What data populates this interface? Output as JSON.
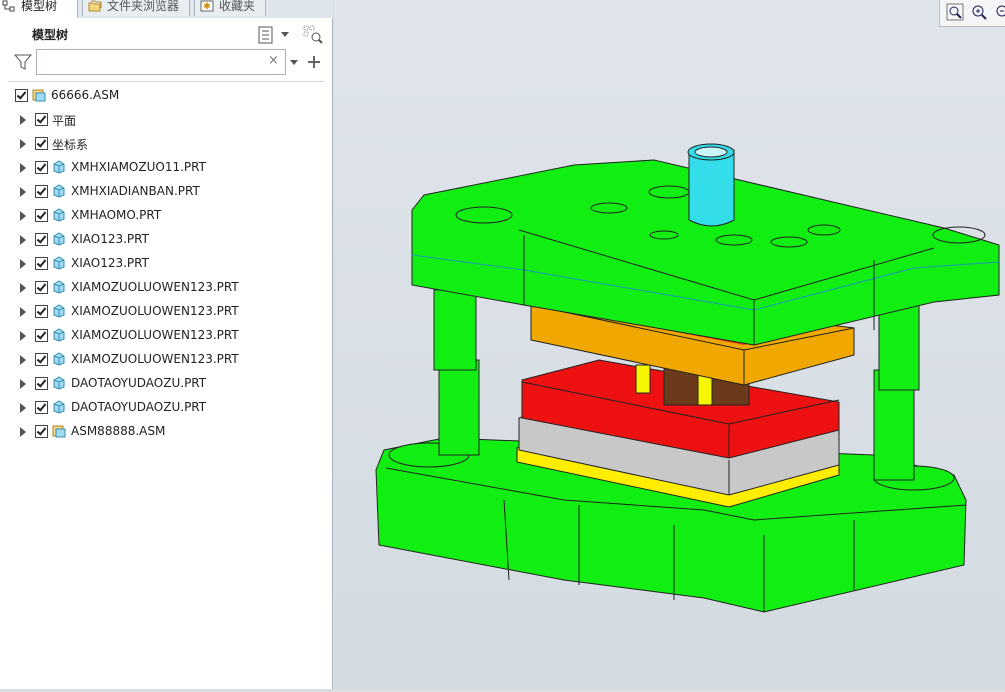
{
  "tabs": [
    {
      "label": "模型树",
      "icon": "model-tree-icon",
      "active": true
    },
    {
      "label": "文件夹浏览器",
      "icon": "folder-browser-icon",
      "active": false
    },
    {
      "label": "收藏夹",
      "icon": "favorites-icon",
      "active": false
    }
  ],
  "panel": {
    "title": "模型树"
  },
  "search": {
    "value": "",
    "clear_symbol": "×"
  },
  "tree": [
    {
      "label": "66666.ASM",
      "icon": "assembly-icon",
      "expandable": false,
      "checked": true
    },
    {
      "label": "平面",
      "icon": "none",
      "expandable": true,
      "checked": true
    },
    {
      "label": "坐标系",
      "icon": "none",
      "expandable": true,
      "checked": true
    },
    {
      "label": "XMHXIAMOZUO11.PRT",
      "icon": "part-icon",
      "expandable": true,
      "checked": true
    },
    {
      "label": "XMHXIADIANBAN.PRT",
      "icon": "part-icon",
      "expandable": true,
      "checked": true
    },
    {
      "label": "XMHAOMO.PRT",
      "icon": "part-icon",
      "expandable": true,
      "checked": true
    },
    {
      "label": "XIAO123.PRT",
      "icon": "part-icon",
      "expandable": true,
      "checked": true
    },
    {
      "label": "XIAO123.PRT",
      "icon": "part-icon",
      "expandable": true,
      "checked": true
    },
    {
      "label": "XIAMOZUOLUOWEN123.PRT",
      "icon": "part-icon",
      "expandable": true,
      "checked": true
    },
    {
      "label": "XIAMOZUOLUOWEN123.PRT",
      "icon": "part-icon",
      "expandable": true,
      "checked": true
    },
    {
      "label": "XIAMOZUOLUOWEN123.PRT",
      "icon": "part-icon",
      "expandable": true,
      "checked": true
    },
    {
      "label": "XIAMOZUOLUOWEN123.PRT",
      "icon": "part-icon",
      "expandable": true,
      "checked": true
    },
    {
      "label": "DAOTAOYUDAOZU.PRT",
      "icon": "part-icon",
      "expandable": true,
      "checked": true
    },
    {
      "label": "DAOTAOYUDAOZU.PRT",
      "icon": "part-icon",
      "expandable": true,
      "checked": true
    },
    {
      "label": "ASM88888.ASM",
      "icon": "assembly-icon",
      "expandable": true,
      "checked": true
    }
  ],
  "colors": {
    "die_set_green": "#11ee11",
    "guide_post_cyan": "#33dde9",
    "punch_plate_orange": "#f0a800",
    "die_plate_red": "#ee1111",
    "backing_plate_gray": "#c8c8c8",
    "base_plate_yellow": "#ffee00",
    "guide_pin_yellow": "#f6f600",
    "punch_brown": "#6b3a1a"
  }
}
